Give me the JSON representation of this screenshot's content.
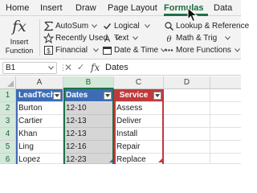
{
  "ribbon_tabs": [
    {
      "label": "Home",
      "active": false
    },
    {
      "label": "Insert",
      "active": false
    },
    {
      "label": "Draw",
      "active": false
    },
    {
      "label": "Page Layout",
      "active": false
    },
    {
      "label": "Formulas",
      "active": true
    },
    {
      "label": "Data",
      "active": false
    }
  ],
  "ribbon": {
    "insert_function": {
      "line1": "Insert",
      "line2": "Function",
      "icon": "fx-icon"
    },
    "col1": [
      {
        "label": "AutoSum",
        "icon": "sigma-icon"
      },
      {
        "label": "Recently Used",
        "icon": "star-icon"
      },
      {
        "label": "Financial",
        "icon": "financial-icon"
      }
    ],
    "col2": [
      {
        "label": "Logical",
        "icon": "logical-icon"
      },
      {
        "label": "Text",
        "icon": "text-icon"
      },
      {
        "label": "Date & Time",
        "icon": "calendar-icon"
      }
    ],
    "col3": [
      {
        "label": "Lookup & Reference",
        "icon": "lookup-icon"
      },
      {
        "label": "Math & Trig",
        "icon": "math-icon"
      },
      {
        "label": "More Functions",
        "icon": "more-icon"
      }
    ]
  },
  "formula_bar": {
    "name_box": "B1",
    "fx_label": "fx",
    "value": "Dates",
    "cancel_symbol": "✕",
    "enter_symbol": "✓",
    "dots_symbol": "⋮"
  },
  "grid": {
    "columns": [
      "A",
      "B",
      "C",
      "D"
    ],
    "selected_column": "B",
    "rows": [
      "1",
      "2",
      "3",
      "4",
      "5",
      "6"
    ],
    "headers": {
      "leadtech": "LeadTech",
      "dates": "Dates",
      "service": "Service"
    },
    "data_rows": [
      {
        "leadtech": "Burton",
        "date": "12-10",
        "service": "Assess"
      },
      {
        "leadtech": "Cartier",
        "date": "12-13",
        "service": "Deliver"
      },
      {
        "leadtech": "Khan",
        "date": "12-13",
        "service": "Install"
      },
      {
        "leadtech": "Ling",
        "date": "12-16",
        "service": "Repair"
      },
      {
        "leadtech": "Lopez",
        "date": "12-23",
        "service": "Replace"
      }
    ]
  },
  "colors": {
    "accent_green": "#1e7145",
    "table_blue": "#3d6cb5",
    "table_red": "#c0393b",
    "selected_fill": "#d6d6d6"
  }
}
